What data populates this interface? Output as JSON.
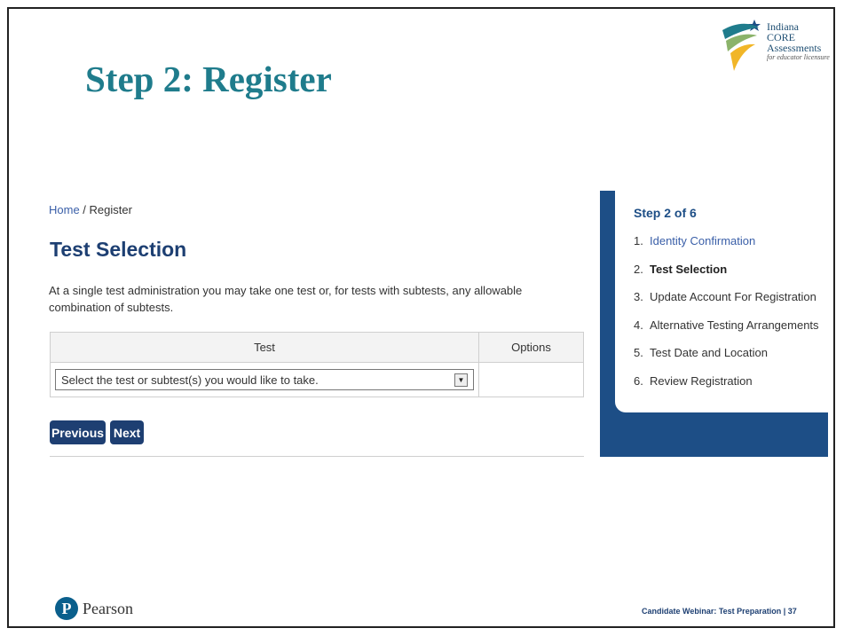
{
  "slide": {
    "title": "Step 2: Register"
  },
  "logo": {
    "line1": "Indiana",
    "line2": "CORE",
    "line3": "Assessments",
    "tagline": "for educator licensure"
  },
  "breadcrumb": {
    "home": "Home",
    "separator": " / ",
    "current": "Register"
  },
  "section": {
    "title": "Test Selection",
    "intro": "At a single test administration you may take one test or, for tests with subtests, any allowable combination of subtests."
  },
  "table": {
    "headers": [
      "Test",
      "Options"
    ],
    "select_value": "Select the test or subtest(s) you would like to take.",
    "options_value": ""
  },
  "buttons": {
    "previous": "Previous",
    "next": "Next"
  },
  "steps": {
    "heading": "Step 2 of 6",
    "items": [
      {
        "num": "1.",
        "label": "Identity Confirmation",
        "state": "link"
      },
      {
        "num": "2.",
        "label": "Test Selection",
        "state": "current"
      },
      {
        "num": "3.",
        "label": "Update Account For Registration",
        "state": "pending"
      },
      {
        "num": "4.",
        "label": "Alternative Testing Arrangements",
        "state": "pending"
      },
      {
        "num": "5.",
        "label": "Test Date and Location",
        "state": "pending"
      },
      {
        "num": "6.",
        "label": "Review Registration",
        "state": "pending"
      }
    ]
  },
  "footer": {
    "brand_mark": "P",
    "brand": "Pearson",
    "text": "Candidate Webinar: Test Preparation | 37"
  },
  "colors": {
    "title_teal": "#1f7c8c",
    "navy": "#1d3f72",
    "panel_blue": "#1d4e86",
    "link_blue": "#3a5fa8"
  },
  "icons": {
    "select_toggle": "chevron-down-icon"
  }
}
